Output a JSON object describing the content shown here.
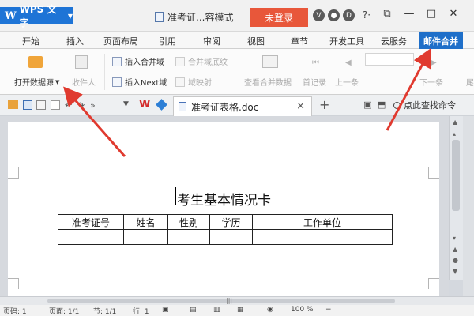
{
  "titlebar": {
    "app_label": "WPS 文字",
    "doc_title": "准考证...容模式",
    "login_label": "未登录",
    "icons": [
      "v-icon",
      "eye-icon",
      "d-icon",
      "help-icon"
    ],
    "help_label": "?·",
    "window_controls": [
      "restore-window-icon",
      "minimize-icon",
      "maximize-icon",
      "close-icon"
    ]
  },
  "tabs": [
    "开始",
    "插入",
    "页面布局",
    "引用",
    "审阅",
    "视图",
    "章节",
    "开发工具",
    "云服务",
    "邮件合并"
  ],
  "active_tab": "邮件合并",
  "ribbon": {
    "open_source": "打开数据源",
    "recipients": "收件人",
    "insert_merge_field": "插入合并域",
    "merge_field_shading": "合并域底纹",
    "insert_next": "插入Next域",
    "field_mapping": "域映射",
    "view_merged_data": "查看合并数据",
    "first_record": "首记录",
    "previous": "上一条",
    "next": "下一条",
    "last": "尾"
  },
  "quickbar": {
    "doc_tab": "准考证表格.doc",
    "find_label": "点此查找命令",
    "wps_glyph": "W"
  },
  "document": {
    "title": "考生基本情况卡",
    "table": {
      "headers": [
        "准考证号",
        "姓名",
        "性别",
        "学历",
        "工作单位"
      ],
      "rows": [
        [
          "",
          "",
          "",
          "",
          ""
        ]
      ]
    }
  },
  "statusbar": {
    "page_num": "页码: 1",
    "pages": "页面: 1/1",
    "section": "节: 1/1",
    "row": "行: 1",
    "zoom": "100 %"
  },
  "colors": {
    "accent": "#1f6fc9",
    "login": "#e8573a",
    "annotation_arrow": "#e03a2f"
  }
}
